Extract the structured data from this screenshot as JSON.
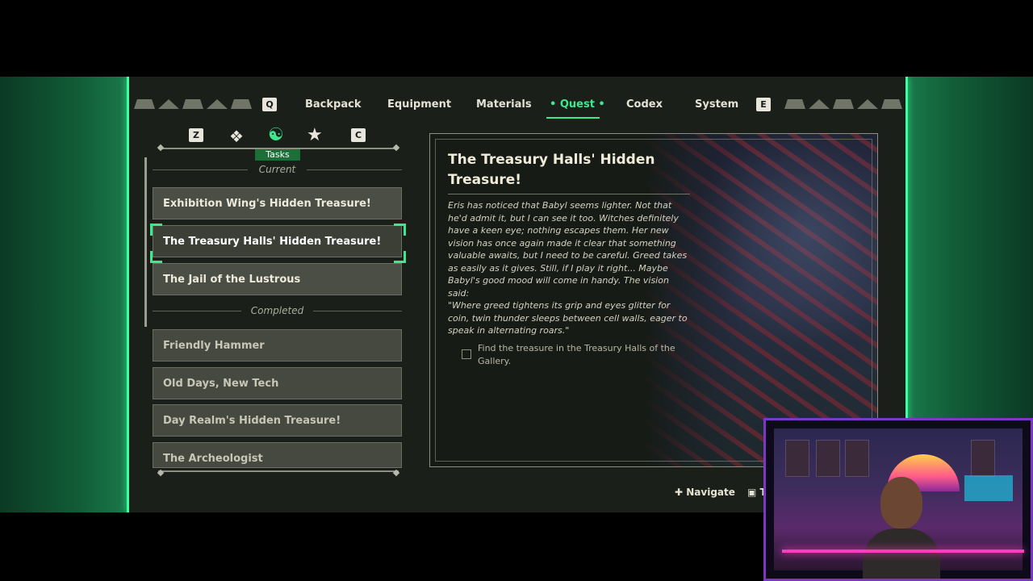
{
  "nav": {
    "left_key": "Q",
    "right_key": "E",
    "tabs": [
      {
        "label": "Backpack"
      },
      {
        "label": "Equipment"
      },
      {
        "label": "Materials"
      },
      {
        "label": "• Quest •"
      },
      {
        "label": "Codex"
      },
      {
        "label": "System"
      }
    ],
    "active_tab": "Quest"
  },
  "subtabs": {
    "left_key": "Z",
    "right_key": "C",
    "icons": [
      "link-icon",
      "tasks-icon",
      "star-icon"
    ],
    "active_label": "Tasks"
  },
  "sections": {
    "current": "Current",
    "completed": "Completed"
  },
  "current_quests": [
    {
      "label": "Exhibition Wing's Hidden Treasure!"
    },
    {
      "label": "The Treasury Halls' Hidden Treasure!"
    },
    {
      "label": "The Jail of the Lustrous"
    }
  ],
  "completed_quests": [
    {
      "label": "Friendly Hammer"
    },
    {
      "label": "Old Days, New Tech"
    },
    {
      "label": "Day Realm's Hidden Treasure!"
    },
    {
      "label": "The Archeologist"
    }
  ],
  "detail": {
    "title": "The Treasury Halls' Hidden Treasure!",
    "description": "Eris has noticed that Babyl seems lighter. Not that he'd admit it, but I can see it too. Witches definitely have a keen eye; nothing escapes them. Her new vision has once again made it clear that something valuable awaits, but I need to be careful. Greed takes as easily as it gives. Still, if I play it right... Maybe Babyl's good mood will come in handy. The vision said:",
    "quote": "\"Where greed tightens its grip and eyes glitter for coin, twin thunder sleeps between cell walls, eager to speak in alternating roars.\"",
    "objective": "Find the treasure in the Treasury Halls of the Gallery."
  },
  "hints": {
    "navigate": "Navigate",
    "track": "Tra"
  },
  "colors": {
    "accent": "#3de88f",
    "panel": "#1a2019",
    "glow": "#1a7a4a"
  }
}
